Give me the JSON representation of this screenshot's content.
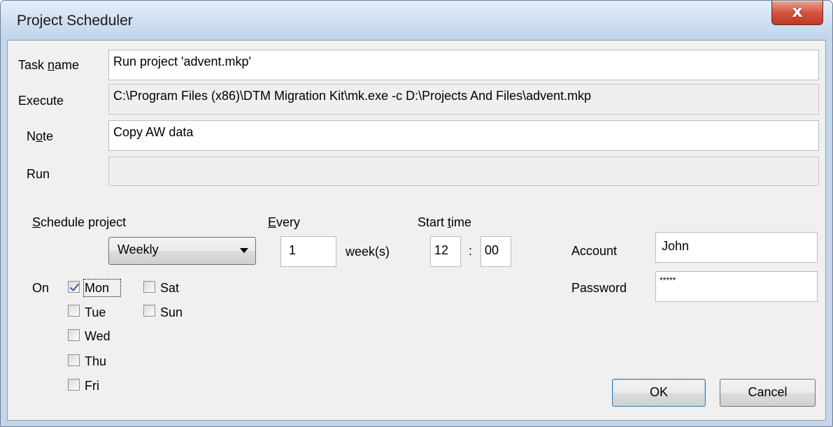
{
  "window": {
    "title": "Project Scheduler",
    "close_label": "x"
  },
  "task": {
    "task_name_label_pre": "Task ",
    "task_name_label_u": "n",
    "task_name_label_post": "ame",
    "task_name_value": "Run project 'advent.mkp'",
    "execute_label": "Execute",
    "execute_value": "C:\\Program Files (x86)\\DTM Migration Kit\\mk.exe -c D:\\Projects And Files\\advent.mkp",
    "note_label_pre": "N",
    "note_label_u": "o",
    "note_label_post": "te",
    "note_value": "Copy AW data",
    "run_label": "Run",
    "run_value": ""
  },
  "schedule": {
    "label_u": "S",
    "label_post": "chedule project",
    "selected": "Weekly",
    "every_label_u": "E",
    "every_label_post": "very",
    "every_value": "1",
    "every_unit": "week(s)",
    "start_label_pre": "Start ",
    "start_label_u": "t",
    "start_label_post": "ime",
    "start_hour": "12",
    "start_sep": ":",
    "start_minute": "00"
  },
  "on": {
    "label": "On",
    "days": [
      {
        "label": "Mon",
        "checked": true
      },
      {
        "label": "Tue",
        "checked": false
      },
      {
        "label": "Wed",
        "checked": false
      },
      {
        "label": "Thu",
        "checked": false
      },
      {
        "label": "Fri",
        "checked": false
      },
      {
        "label": "Sat",
        "checked": false
      },
      {
        "label": "Sun",
        "checked": false
      }
    ]
  },
  "credentials": {
    "account_label": "Account",
    "account_value": "John",
    "password_label": "Password",
    "password_value": "*****"
  },
  "buttons": {
    "ok": "OK",
    "cancel": "Cancel"
  }
}
